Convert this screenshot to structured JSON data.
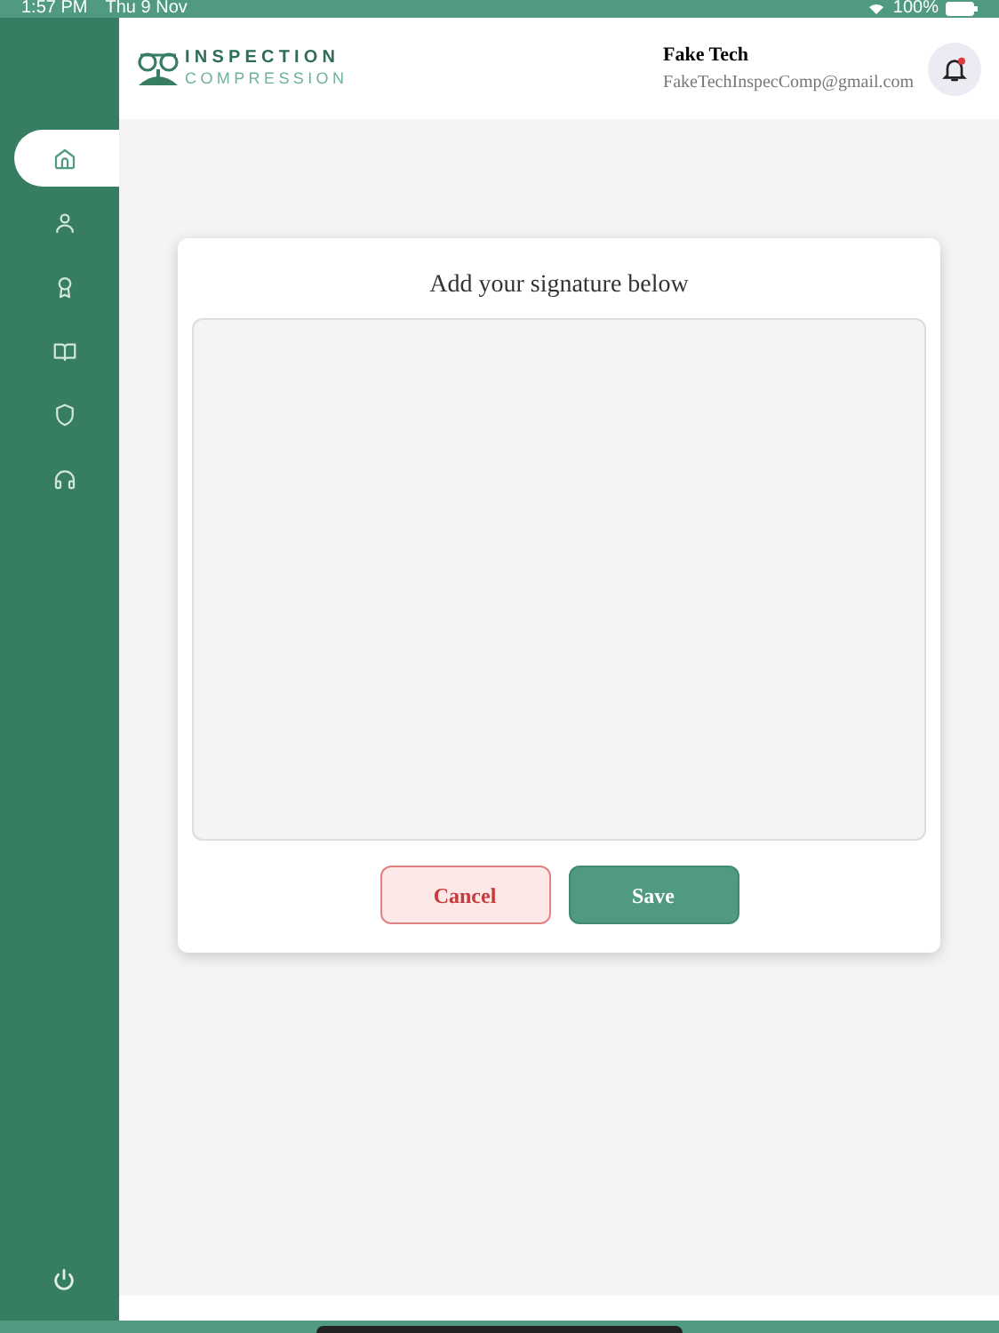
{
  "status_bar": {
    "time": "1:57 PM",
    "date": "Thu 9 Nov",
    "battery": "100%"
  },
  "sidebar": {
    "items": [
      {
        "selected": true
      },
      {
        "selected": false
      },
      {
        "selected": false
      },
      {
        "selected": false
      },
      {
        "selected": false
      },
      {
        "selected": false
      }
    ]
  },
  "header": {
    "logo_top": "INSPECTION",
    "logo_bottom": "COMPRESSION",
    "user_name": "Fake Tech",
    "user_email": "FakeTechInspecComp@gmail.com",
    "notification": true
  },
  "dialog": {
    "title": "Add your signature below",
    "buttons": [
      {
        "label": "Cancel",
        "kind": "cancel"
      },
      {
        "label": "Save",
        "kind": "save"
      }
    ]
  }
}
